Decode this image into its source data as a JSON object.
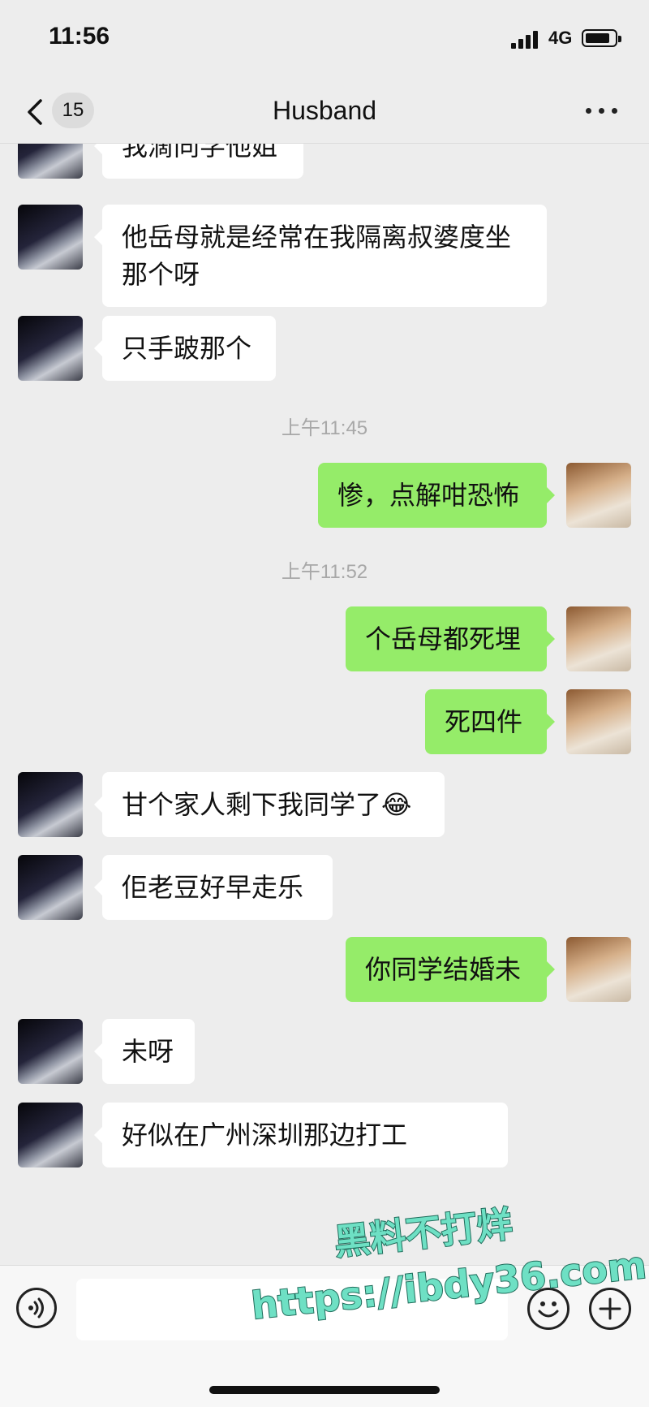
{
  "status": {
    "time": "11:56",
    "network": "4G",
    "battery_level": 0.85
  },
  "nav": {
    "back_count": "15",
    "title": "Husband"
  },
  "messages": [
    {
      "side": "in",
      "text": "我滴同学他姐"
    },
    {
      "side": "in",
      "text": "他岳母就是经常在我隔离叔婆度坐\n那个呀"
    },
    {
      "side": "in",
      "text": "只手跛那个"
    },
    {
      "stamp": "上午11:45"
    },
    {
      "side": "out",
      "text": "惨，点解咁恐怖"
    },
    {
      "stamp": "上午11:52"
    },
    {
      "side": "out",
      "text": "个岳母都死埋"
    },
    {
      "side": "out",
      "text": "死四件"
    },
    {
      "side": "in",
      "text": "甘个家人剩下我同学了",
      "emoji": "😂"
    },
    {
      "side": "in",
      "text": "佢老豆好早走乐"
    },
    {
      "side": "out",
      "text": "你同学结婚未"
    },
    {
      "side": "in",
      "text": "未呀"
    },
    {
      "side": "in",
      "text": "好似在广州深圳那边打工"
    }
  ],
  "watermark": {
    "line1": "黑料不打烊",
    "line2": "https://ibdy36.com"
  },
  "colors": {
    "outgoing_bubble": "#95ec69",
    "incoming_bubble": "#ffffff",
    "background": "#ededed"
  },
  "icons": [
    "back-chevron-icon",
    "more-dots-icon",
    "voice-icon",
    "emoji-icon",
    "plus-icon"
  ]
}
